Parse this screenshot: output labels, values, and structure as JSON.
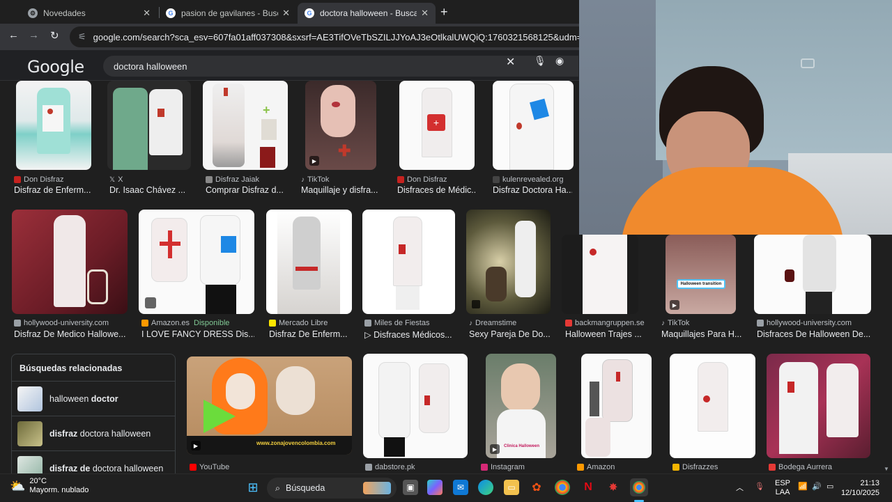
{
  "browser": {
    "tabs": [
      {
        "title": "Novedades",
        "active": false
      },
      {
        "title": "pasion de gavilanes - Buscar co",
        "active": false
      },
      {
        "title": "doctora halloween - Buscar con",
        "active": true
      }
    ],
    "new_tab": "+",
    "url": "google.com/search?sca_esv=607fa01aff037308&sxsrf=AE3TifOVeTbSZILJJYoAJ3eOtlkalUWQiQ:1760321568125&udm=2&fbs=AIljpHx4n..."
  },
  "google": {
    "logo": "Google",
    "query": "doctora halloween"
  },
  "row1": [
    {
      "source": "Don Disfraz",
      "caption": "Disfraz de Enferm...",
      "icon_color": "#c5221f"
    },
    {
      "source": "X",
      "caption": "Dr. Isaac Chávez ...",
      "icon_color": "#000000"
    },
    {
      "source": "Disfraz Jaiak",
      "caption": "Comprar Disfraz d...",
      "icon_color": "#888888"
    },
    {
      "source": "TikTok",
      "caption": "Maquillaje y disfra...",
      "icon_color": "#000000"
    },
    {
      "source": "Don Disfraz",
      "caption": "Disfraces de Médic...",
      "icon_color": "#c5221f"
    },
    {
      "source": "kulenrevealed.org",
      "caption": "Disfraz Doctora Ha...",
      "icon_color": "#444444"
    }
  ],
  "row2": [
    {
      "source": "hollywood-university.com",
      "caption": "Disfraz De Medico Hallowe...",
      "available": ""
    },
    {
      "source": "Amazon.es",
      "caption": "I LOVE FANCY DRESS Dis...",
      "available": "Disponible"
    },
    {
      "source": "Mercado Libre",
      "caption": "Disfraz De Enferm...",
      "available": ""
    },
    {
      "source": "Miles de Fiestas",
      "caption": "▷ Disfraces Médicos...",
      "available": ""
    },
    {
      "source": "Dreamstime",
      "caption": "Sexy Pareja De Do...",
      "available": ""
    },
    {
      "source": "backmangruppen.se",
      "caption": "Halloween Trajes ...",
      "available": ""
    },
    {
      "source": "TikTok",
      "caption": "Maquillajes Para H...",
      "available": ""
    },
    {
      "source": "hollywood-university.com",
      "caption": "Disfraces De Halloween De...",
      "available": ""
    }
  ],
  "related": {
    "title": "Búsquedas relacionadas",
    "items": [
      {
        "plain": "halloween ",
        "bold": "doctor",
        "bold_first": false
      },
      {
        "plain": " doctora halloween",
        "bold": "disfraz",
        "bold_first": true
      },
      {
        "plain": " doctora halloween",
        "bold": "disfraz de",
        "bold_first": true
      }
    ]
  },
  "row3": [
    {
      "source": "YouTube",
      "overlay_text": "www.zonajovencolombia.com"
    },
    {
      "source": "dabstore.pk"
    },
    {
      "source": "Instagram",
      "overlay_text": "Clinica Halloween"
    },
    {
      "source": "Amazon"
    },
    {
      "source": "Disfrazzes"
    },
    {
      "source": "Bodega Aurrera"
    }
  ],
  "taskbar": {
    "temperature": "20°C",
    "weather": "Mayorm. nublado",
    "search": "Búsqueda",
    "lang1": "ESP",
    "lang2": "LAA",
    "time": "21:13",
    "date": "12/10/2025"
  },
  "colors": {
    "background": "#1f1f1f",
    "accent_red": "#c5221f",
    "available_green": "#81c995"
  }
}
